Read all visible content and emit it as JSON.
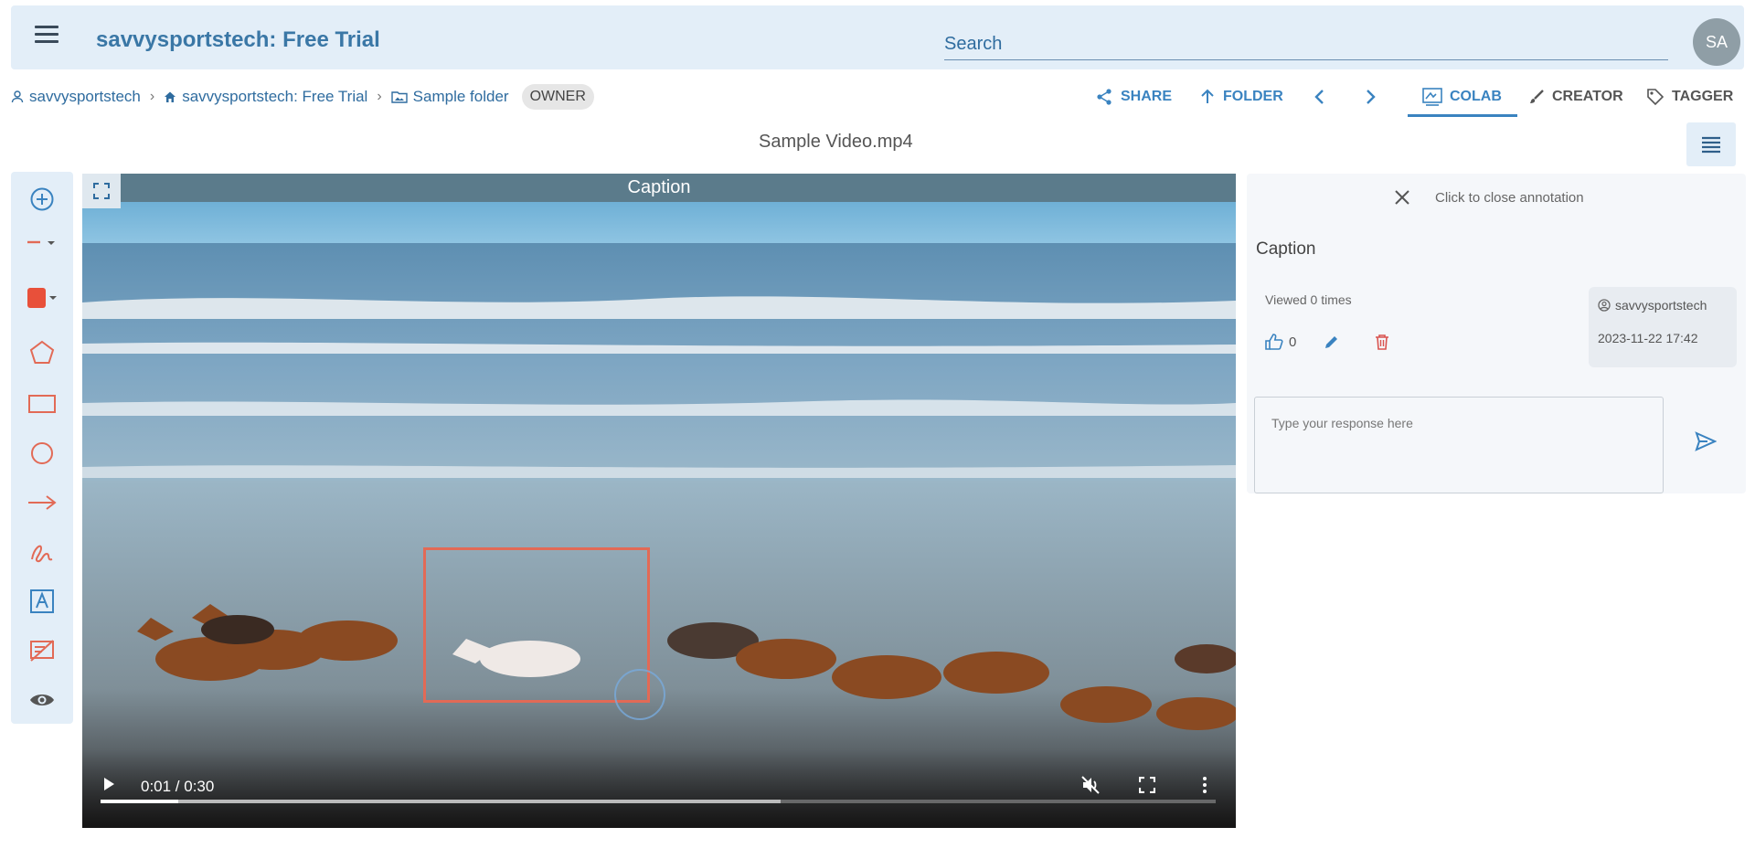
{
  "header": {
    "app_title": "savvysportstech: Free Trial",
    "search_placeholder": "Search",
    "avatar_initials": "SA"
  },
  "breadcrumb": [
    {
      "label": "savvysportstech",
      "icon": "person-icon"
    },
    {
      "label": "savvysportstech: Free Trial",
      "icon": "home-icon"
    },
    {
      "label": "Sample folder",
      "icon": "folder-image-icon"
    }
  ],
  "owner_badge": "OWNER",
  "actions": {
    "share": "SHARE",
    "folder": "FOLDER",
    "colab": "COLAB",
    "creator": "CREATOR",
    "tagger": "TAGGER"
  },
  "file_title": "Sample Video.mp4",
  "tools": [
    "add-circle-icon",
    "line-style-icon",
    "color-swatch-icon",
    "polygon-icon",
    "rectangle-icon",
    "circle-icon",
    "arrow-icon",
    "freehand-icon",
    "text-box-icon",
    "hide-annotations-icon",
    "eye-icon"
  ],
  "video": {
    "caption": "Caption",
    "time": "0:01 / 0:30",
    "progress_played": 0.07,
    "progress_buffered": 0.61
  },
  "panel": {
    "close_label": "Click to close annotation",
    "title": "Caption",
    "viewed": "Viewed 0 times",
    "likes": "0",
    "author": "savvysportstech",
    "date": "2023-11-22 17:42",
    "reply_placeholder": "Type your response here"
  },
  "colors": {
    "accent": "#3a83c0",
    "header_bg": "#e3eef8",
    "annotation_red": "#e26a56",
    "delete_red": "#d9534f"
  }
}
